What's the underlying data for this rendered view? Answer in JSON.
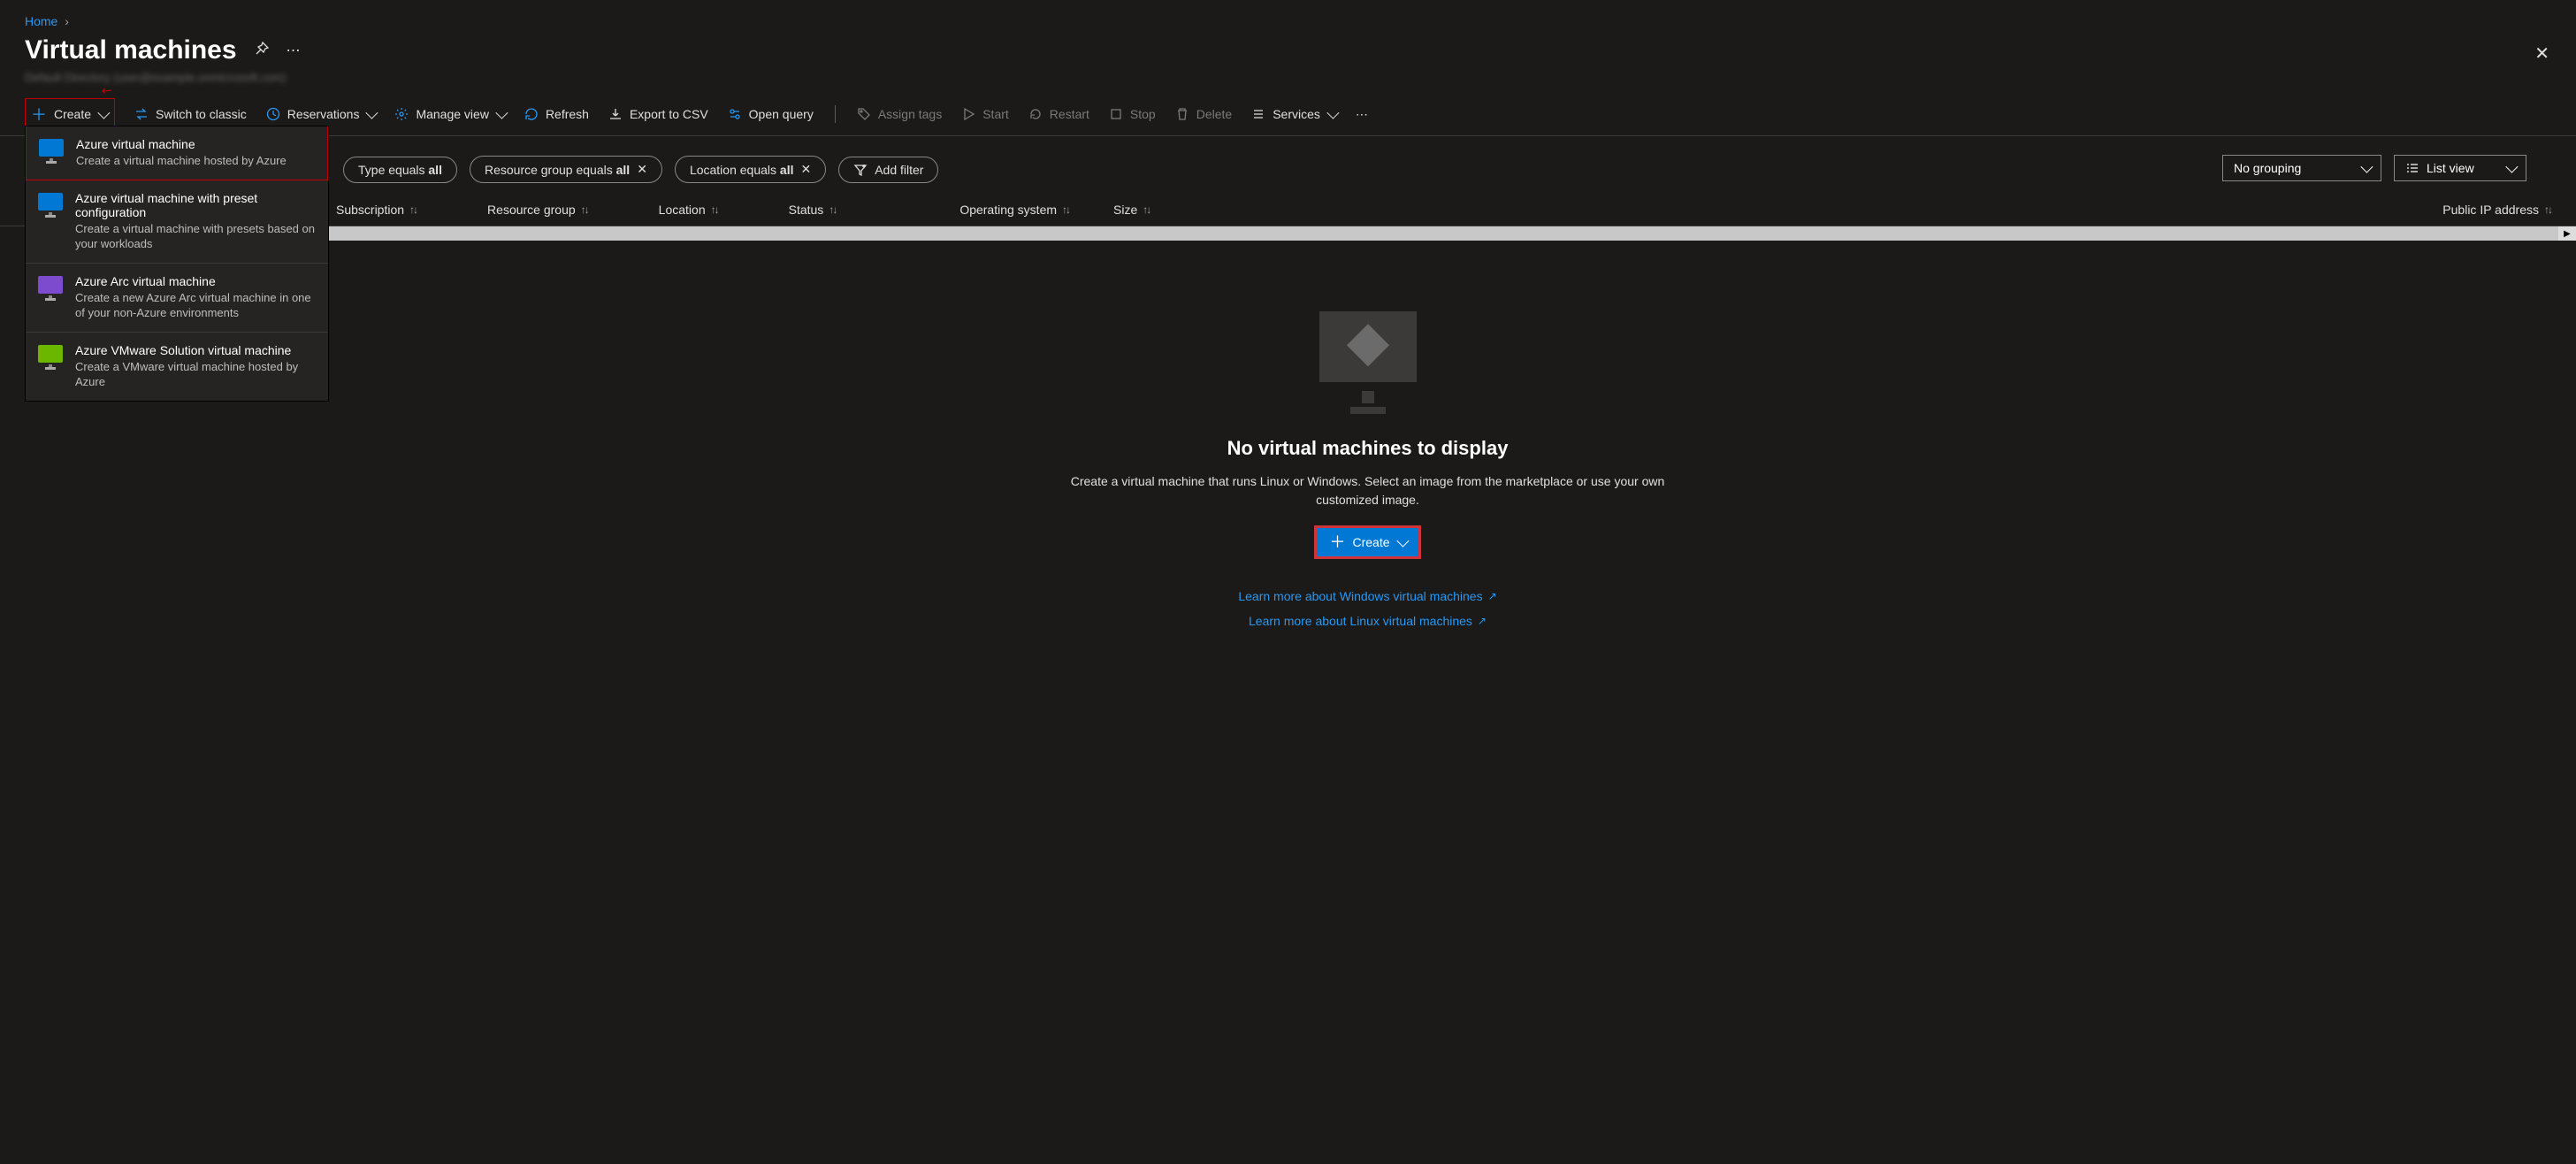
{
  "breadcrumb": {
    "home": "Home"
  },
  "page": {
    "title": "Virtual machines",
    "sub_directory": "Default Directory (user@example.onmicrosoft.com)"
  },
  "toolbar": {
    "create": "Create",
    "switch_classic": "Switch to classic",
    "reservations": "Reservations",
    "manage_view": "Manage view",
    "refresh": "Refresh",
    "export_csv": "Export to CSV",
    "open_query": "Open query",
    "assign_tags": "Assign tags",
    "start": "Start",
    "restart": "Restart",
    "stop": "Stop",
    "delete": "Delete",
    "services": "Services"
  },
  "create_menu": [
    {
      "title": "Azure virtual machine",
      "sub": "Create a virtual machine hosted by Azure",
      "color": "#0078d4"
    },
    {
      "title": "Azure virtual machine with preset configuration",
      "sub": "Create a virtual machine with presets based on your workloads",
      "color": "#0078d4"
    },
    {
      "title": "Azure Arc virtual machine",
      "sub": "Create a new Azure Arc virtual machine in one of your non-Azure environments",
      "color": "#7d4bcd"
    },
    {
      "title": "Azure VMware Solution virtual machine",
      "sub": "Create a VMware virtual machine hosted by Azure",
      "color": "#6bb700"
    }
  ],
  "filters": {
    "type_prefix": "Type equals ",
    "type_value": "all",
    "rg_prefix": "Resource group equals ",
    "rg_value": "all",
    "loc_prefix": "Location equals ",
    "loc_value": "all",
    "add_filter": "Add filter"
  },
  "view_controls": {
    "grouping": "No grouping",
    "list_view": "List view"
  },
  "columns": {
    "subscription": "Subscription",
    "resource_group": "Resource group",
    "location": "Location",
    "status": "Status",
    "operating_system": "Operating system",
    "size": "Size",
    "public_ip": "Public IP address"
  },
  "empty": {
    "heading": "No virtual machines to display",
    "desc": "Create a virtual machine that runs Linux or Windows. Select an image from the marketplace or use your own customized image.",
    "create_button": "Create",
    "learn_windows": "Learn more about Windows virtual machines",
    "learn_linux": "Learn more about Linux virtual machines"
  }
}
